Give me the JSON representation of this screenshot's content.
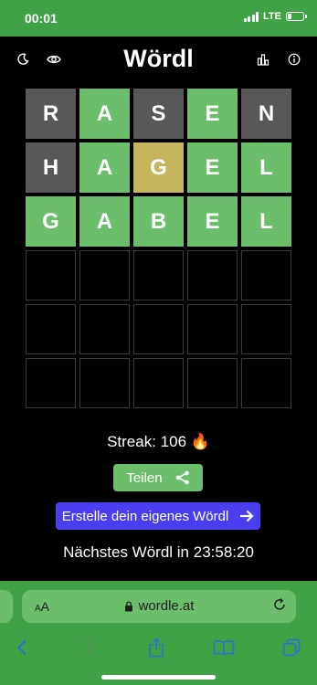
{
  "status": {
    "time": "00:01",
    "carrier": "LTE"
  },
  "header": {
    "title": "Wördl",
    "icons": [
      "moon-icon",
      "eye-icon",
      "stats-icon",
      "info-icon"
    ]
  },
  "board": {
    "rows": [
      [
        {
          "l": "R",
          "s": "absent"
        },
        {
          "l": "A",
          "s": "correct"
        },
        {
          "l": "S",
          "s": "absent"
        },
        {
          "l": "E",
          "s": "correct"
        },
        {
          "l": "N",
          "s": "absent"
        }
      ],
      [
        {
          "l": "H",
          "s": "absent"
        },
        {
          "l": "A",
          "s": "correct"
        },
        {
          "l": "G",
          "s": "present"
        },
        {
          "l": "E",
          "s": "correct"
        },
        {
          "l": "L",
          "s": "correct"
        }
      ],
      [
        {
          "l": "G",
          "s": "correct"
        },
        {
          "l": "A",
          "s": "correct"
        },
        {
          "l": "B",
          "s": "correct"
        },
        {
          "l": "E",
          "s": "correct"
        },
        {
          "l": "L",
          "s": "correct"
        }
      ],
      [
        {
          "l": "",
          "s": "empty"
        },
        {
          "l": "",
          "s": "empty"
        },
        {
          "l": "",
          "s": "empty"
        },
        {
          "l": "",
          "s": "empty"
        },
        {
          "l": "",
          "s": "empty"
        }
      ],
      [
        {
          "l": "",
          "s": "empty"
        },
        {
          "l": "",
          "s": "empty"
        },
        {
          "l": "",
          "s": "empty"
        },
        {
          "l": "",
          "s": "empty"
        },
        {
          "l": "",
          "s": "empty"
        }
      ],
      [
        {
          "l": "",
          "s": "empty"
        },
        {
          "l": "",
          "s": "empty"
        },
        {
          "l": "",
          "s": "empty"
        },
        {
          "l": "",
          "s": "empty"
        },
        {
          "l": "",
          "s": "empty"
        }
      ]
    ]
  },
  "result": {
    "streak": "Streak: 106 🔥",
    "share_label": "Teilen",
    "create_label": "Erstelle dein eigenes Wördl",
    "next_label": "Nächstes Wördl in 23:58:20"
  },
  "browser": {
    "text_size_small": "A",
    "text_size_large": "A",
    "url": "wordle.at"
  },
  "colors": {
    "correct": "#6cbf6a",
    "present": "#c5b55c",
    "absent": "#585858",
    "accent": "#4b3ef0",
    "browser": "#3fa244"
  }
}
